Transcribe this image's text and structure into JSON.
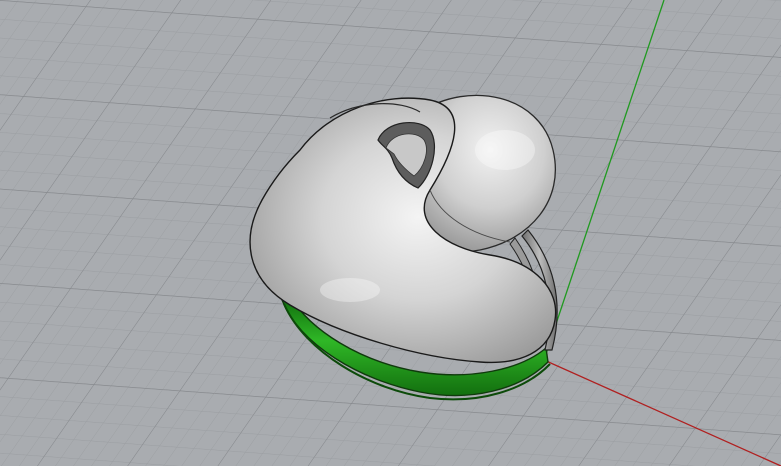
{
  "viewport": {
    "projection": "perspective",
    "display_mode": "rendered",
    "grid": true,
    "world_axes": true,
    "background_color": "#a9acb0",
    "grid_minor_color": "#9a9da1",
    "grid_major_color": "#7f8286",
    "x_axis_color": "#b02020",
    "y_axis_color": "#1f9a1f"
  },
  "model": {
    "object": "ring",
    "top_surface_color": "#d9d9d9",
    "band_highlight_color": "#22a51c",
    "band_color": "#1c8a17",
    "edge_color": "#1a1a1a"
  }
}
